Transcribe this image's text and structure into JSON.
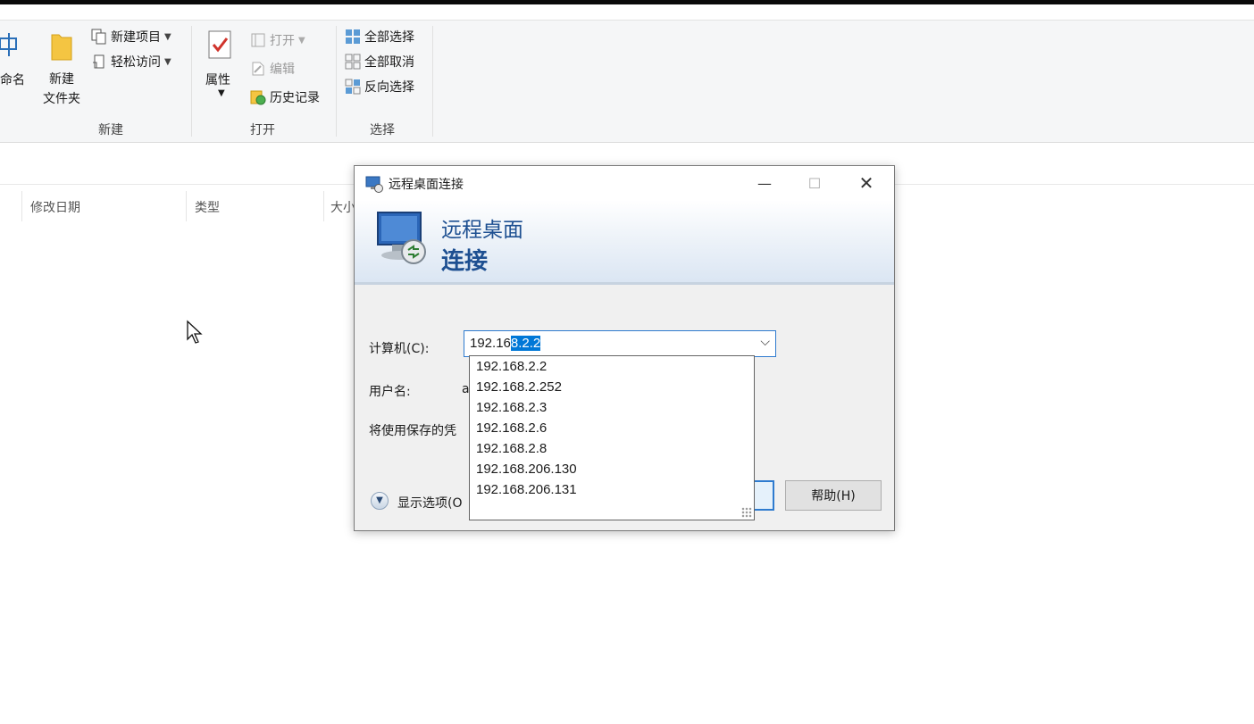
{
  "ribbon": {
    "rename_partial": "命名",
    "new_folder": "新建\n文件夹",
    "new_item": "新建项目",
    "easy_access": "轻松访问",
    "group_new": "新建",
    "properties": "属性",
    "open": "打开",
    "edit": "编辑",
    "history": "历史记录",
    "group_open": "打开",
    "select_all": "全部选择",
    "select_none": "全部取消",
    "invert_selection": "反向选择",
    "group_select": "选择"
  },
  "columns": {
    "modified": "修改日期",
    "type": "类型",
    "size_partial": "大小"
  },
  "dialog": {
    "title": "远程桌面连接",
    "banner_line1": "远程桌面",
    "banner_line2": "连接",
    "computer_label": "计算机(C):",
    "computer_value_plain": "192.16",
    "computer_value_selected": "8.2.2",
    "username_label": "用户名:",
    "username_value_partial": "a",
    "saved_creds_partial": "将使用保存的凭",
    "show_options_partial": "显示选项(O",
    "help_button": "帮助(H)",
    "history_items": [
      "192.168.2.2",
      "192.168.2.252",
      "192.168.2.3",
      "192.168.2.6",
      "192.168.2.8",
      "192.168.206.130",
      "192.168.206.131"
    ]
  },
  "colors": {
    "accent": "#0078d7",
    "banner_text": "#1d4f91"
  }
}
